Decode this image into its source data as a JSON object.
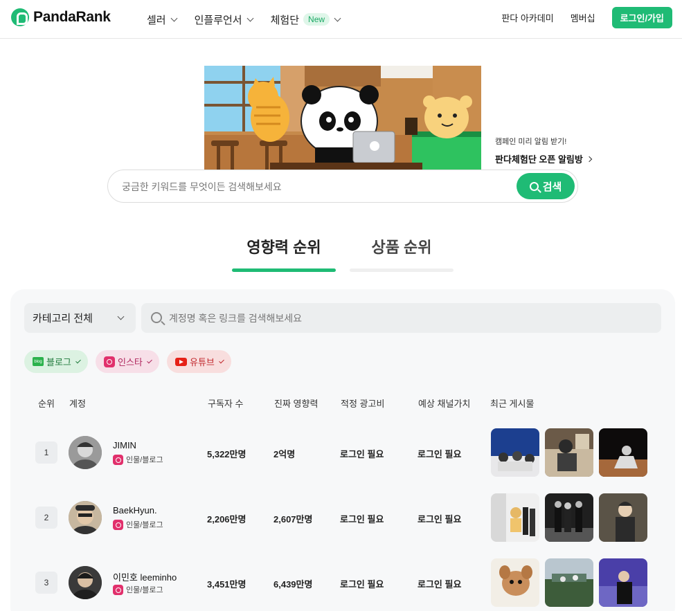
{
  "nav": {
    "logo_text": "PandaRank",
    "menu": [
      {
        "label": "셀러"
      },
      {
        "label": "인플루언서"
      },
      {
        "label": "체험단",
        "badge": "New"
      }
    ],
    "links": {
      "academy": "판다 아카데미",
      "membership": "멤버십"
    },
    "login_label": "로그인/가입"
  },
  "hero": {
    "notice_small": "캠페인 미리 알림 받기!",
    "notice_big": "판다체험단 오픈 알림방"
  },
  "search": {
    "placeholder": "궁금한 키워드를 무엇이든 검색해보세요",
    "button_label": "검색"
  },
  "tabs": [
    {
      "label": "영향력 순위",
      "active": true
    },
    {
      "label": "상품 순위",
      "active": false
    }
  ],
  "filters": {
    "category_label": "카테고리 전체",
    "account_search_placeholder": "계정명 혹은 링크를 검색해보세요",
    "chips": [
      {
        "label": "블로그",
        "icon": "blog-icon",
        "blog_icon_text": "blog"
      },
      {
        "label": "인스타",
        "icon": "instagram-icon"
      },
      {
        "label": "유튜브",
        "icon": "youtube-icon"
      }
    ]
  },
  "table": {
    "headers": [
      "순위",
      "계정",
      "구독자 수",
      "진짜 영향력",
      "적정 광고비",
      "예상 채널가치",
      "최근 게시물"
    ],
    "rows": [
      {
        "rank": "1",
        "name": "JIMIN",
        "category": "인물/블로그",
        "subscribers": "5,322만명",
        "influence": "2억명",
        "ad_cost": "로그인 필요",
        "channel_value": "로그인 필요"
      },
      {
        "rank": "2",
        "name": "BaekHyun.",
        "category": "인물/블로그",
        "subscribers": "2,206만명",
        "influence": "2,607만명",
        "ad_cost": "로그인 필요",
        "channel_value": "로그인 필요"
      },
      {
        "rank": "3",
        "name": "이민호 leeminho",
        "category": "인물/블로그",
        "subscribers": "3,451만명",
        "influence": "6,439만명",
        "ad_cost": "로그인 필요",
        "channel_value": "로그인 필요"
      }
    ]
  },
  "colors": {
    "accent": "#1fbb75",
    "panel_bg": "#f7f8f9"
  }
}
